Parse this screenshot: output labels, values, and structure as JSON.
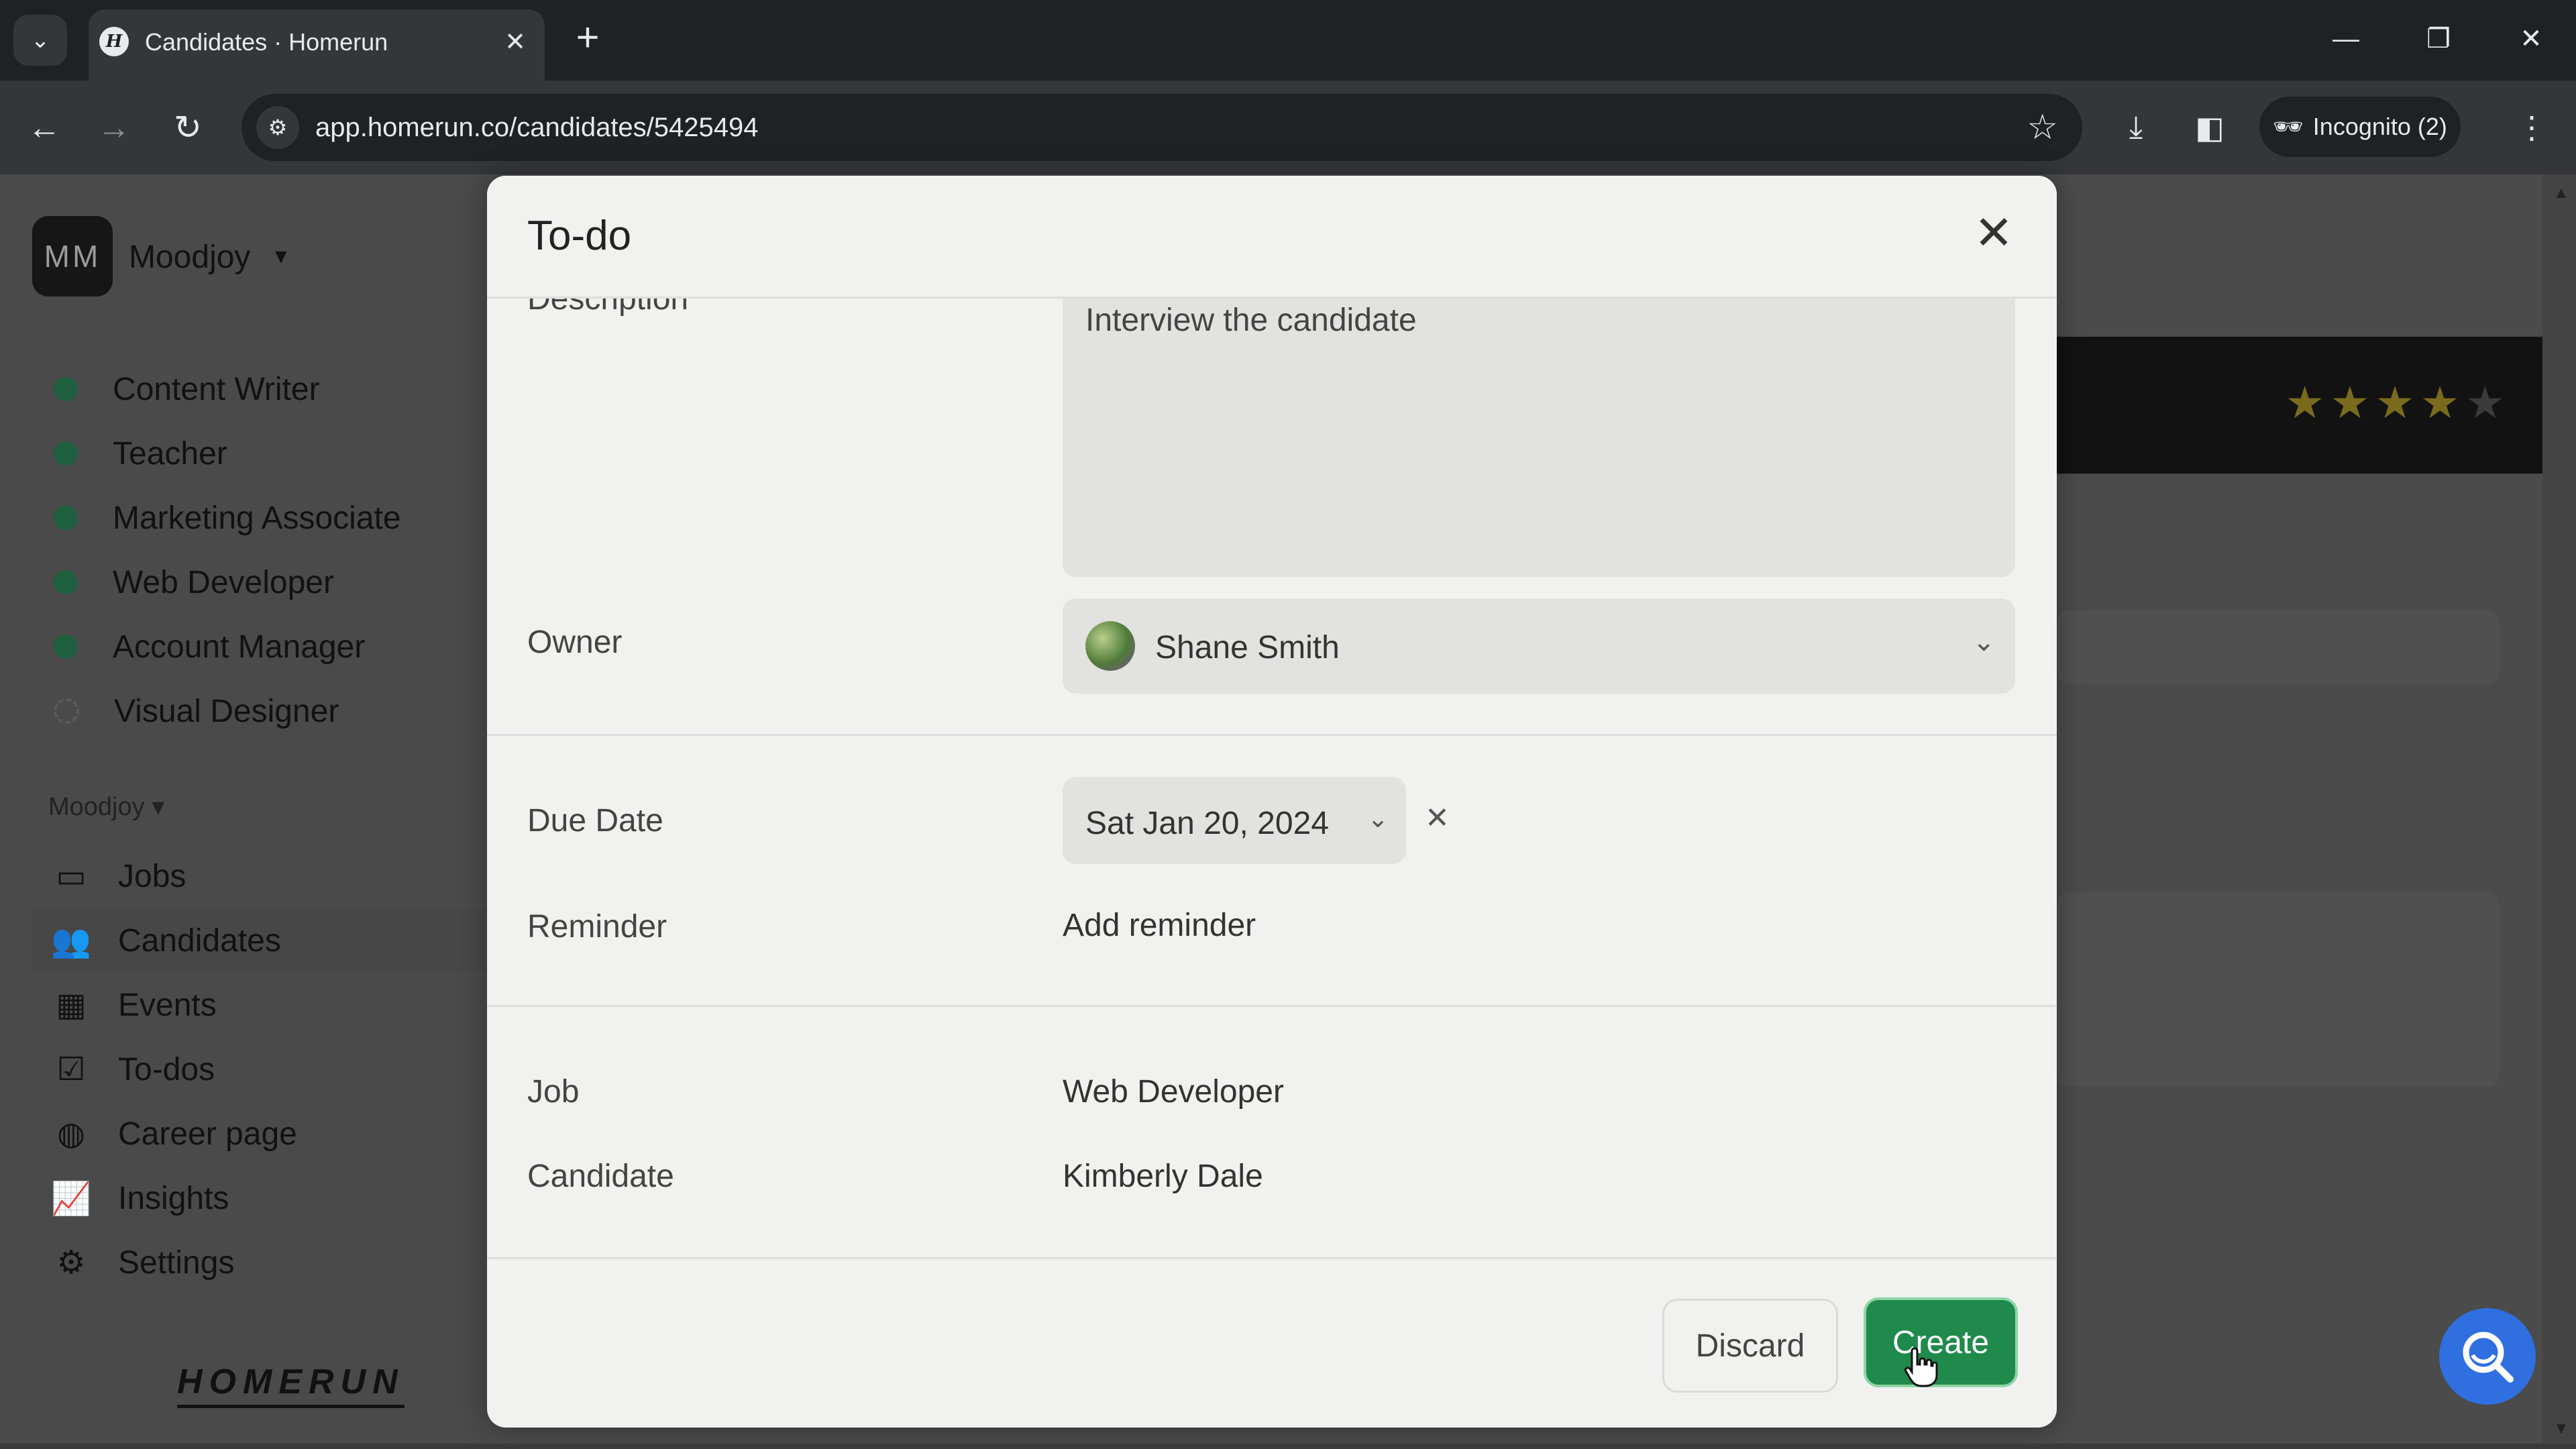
{
  "browser": {
    "tab_title": "Candidates · Homerun",
    "url": "app.homerun.co/candidates/5425494",
    "incognito_label": "Incognito (2)"
  },
  "sidebar": {
    "org_initials": "MM",
    "org_name": "Moodjoy",
    "jobs": [
      {
        "label": "Content Writer",
        "status": "active"
      },
      {
        "label": "Teacher",
        "status": "active"
      },
      {
        "label": "Marketing Associate",
        "status": "active"
      },
      {
        "label": "Web Developer",
        "status": "active"
      },
      {
        "label": "Account Manager",
        "status": "active"
      },
      {
        "label": "Visual Designer",
        "status": "draft"
      }
    ],
    "section_label": "Moodjoy",
    "nav": [
      {
        "label": "Jobs",
        "icon": "briefcase-icon"
      },
      {
        "label": "Candidates",
        "icon": "people-icon"
      },
      {
        "label": "Events",
        "icon": "calendar-icon"
      },
      {
        "label": "To-dos",
        "icon": "checkbox-icon"
      },
      {
        "label": "Career page",
        "icon": "globe-icon"
      },
      {
        "label": "Insights",
        "icon": "chart-line-icon"
      },
      {
        "label": "Settings",
        "icon": "gear-icon"
      }
    ],
    "brand": "HOMERUN"
  },
  "candidate_rating": {
    "value": 4,
    "max": 5
  },
  "modal": {
    "title": "To-do",
    "description_label": "Description",
    "description_value": "Interview the candidate",
    "owner_label": "Owner",
    "owner_value": "Shane Smith",
    "due_date_label": "Due Date",
    "due_date_value": "Sat Jan 20, 2024",
    "reminder_label": "Reminder",
    "reminder_action": "Add reminder",
    "job_label": "Job",
    "job_value": "Web Developer",
    "candidate_label": "Candidate",
    "candidate_value": "Kimberly Dale",
    "discard_label": "Discard",
    "create_label": "Create"
  },
  "colors": {
    "primary_green": "#1f8a4c",
    "job_dot": "#1e5f3f",
    "help_blue": "#2f6fe0"
  }
}
